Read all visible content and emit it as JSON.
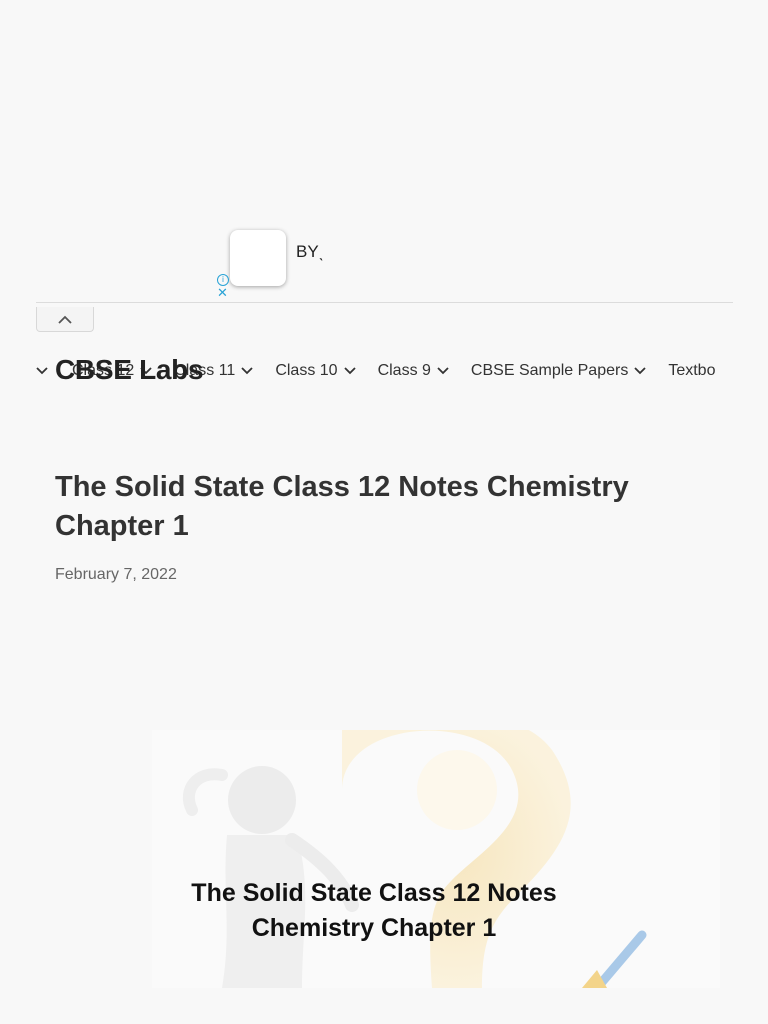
{
  "ad": {
    "text": "BYˎ",
    "info_icon": "info-icon",
    "close_icon": "close-icon"
  },
  "nav": {
    "items": [
      {
        "label": "Class 12"
      },
      {
        "label": "Class 11"
      },
      {
        "label": "Class 10"
      },
      {
        "label": "Class 9"
      },
      {
        "label": "CBSE Sample Papers"
      },
      {
        "label": "Textbo"
      }
    ]
  },
  "site": {
    "brand": "CBSE Labs"
  },
  "post": {
    "title": "The Solid State Class 12 Notes Chemistry Chapter 1",
    "date": "February 7, 2022",
    "featured_image_text": "The Solid State Class 12 Notes Chemistry Chapter 1"
  },
  "colors": {
    "ad_accent": "#29a3d6",
    "text": "#333333",
    "background": "#f8f8f8"
  }
}
